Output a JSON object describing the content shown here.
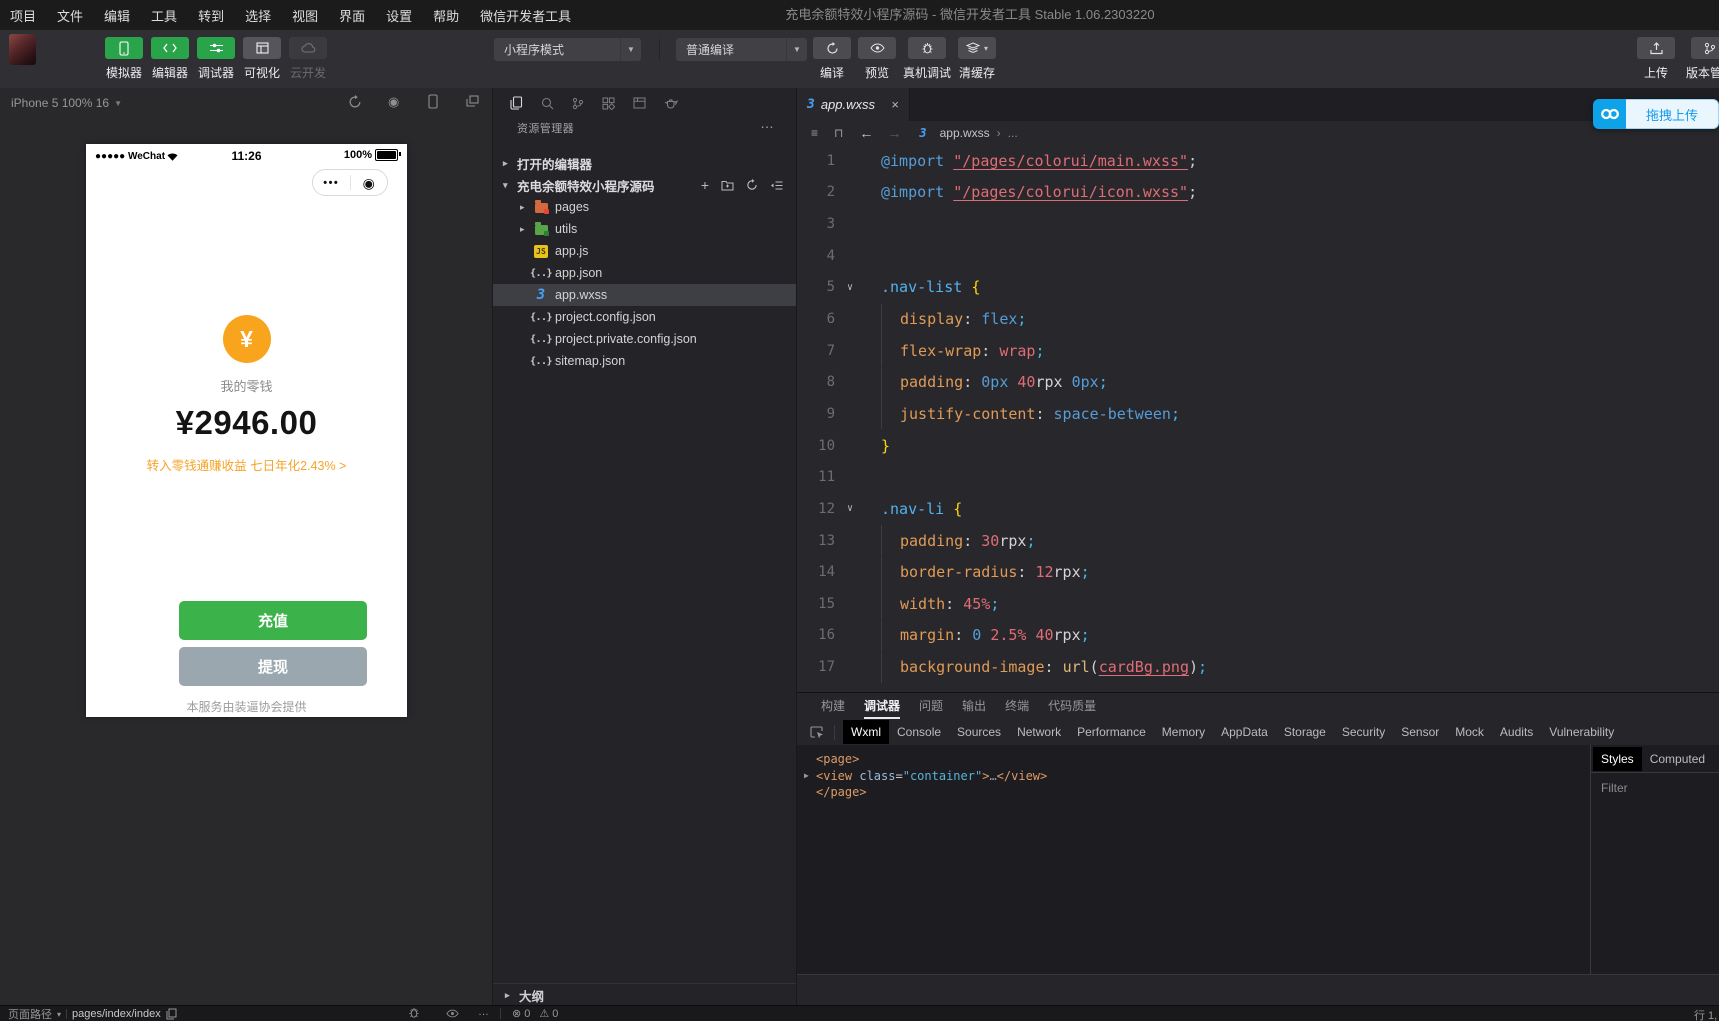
{
  "window": {
    "menu": [
      "项目",
      "文件",
      "编辑",
      "工具",
      "转到",
      "选择",
      "视图",
      "界面",
      "设置",
      "帮助",
      "微信开发者工具"
    ],
    "title": "充电余额特效小程序源码 - 微信开发者工具 Stable 1.06.2303220"
  },
  "toolbar": {
    "mode_buttons": [
      {
        "label": "模拟器",
        "icon": "phone",
        "state": "active"
      },
      {
        "label": "编辑器",
        "icon": "code",
        "state": "active"
      },
      {
        "label": "调试器",
        "icon": "sliders",
        "state": "active"
      },
      {
        "label": "可视化",
        "icon": "layout",
        "state": "normal"
      },
      {
        "label": "云开发",
        "icon": "cloud",
        "state": "disabled"
      }
    ],
    "mode_select": "小程序模式",
    "compile_select": "普通编译",
    "action_buttons": [
      {
        "label": "编译",
        "icon": "refresh"
      },
      {
        "label": "预览",
        "icon": "eye"
      },
      {
        "label": "真机调试",
        "icon": "bug"
      },
      {
        "label": "清缓存",
        "icon": "layers",
        "caret": true
      }
    ],
    "right_buttons": [
      {
        "label": "上传",
        "icon": "upload"
      },
      {
        "label": "版本管理",
        "icon": "branch"
      }
    ],
    "drag_upload_label": "拖拽上传"
  },
  "simulator": {
    "device": "iPhone 5 100% 16",
    "carrier": "●●●●● WeChat",
    "time": "11:26",
    "battery": "100%",
    "capsule_dots": "•••",
    "capsule_target": "◉",
    "coin_symbol": "¥",
    "wallet_label": "我的零钱",
    "balance": "¥2946.00",
    "promo_link": "转入零钱通赚收益 七日年化2.43% >",
    "recharge_label": "充值",
    "withdraw_label": "提现",
    "footer": "本服务由装逼协会提供"
  },
  "explorer": {
    "title": "资源管理器",
    "more": "…",
    "open_editors": "打开的编辑器",
    "project": "充电余额特效小程序源码",
    "files": [
      {
        "label": "pages",
        "icon": "folder-orange",
        "arrow": true
      },
      {
        "label": "utils",
        "icon": "folder-green",
        "arrow": true
      },
      {
        "label": "app.js",
        "icon": "js"
      },
      {
        "label": "app.json",
        "icon": "json"
      },
      {
        "label": "app.wxss",
        "icon": "wxss",
        "selected": true
      },
      {
        "label": "project.config.json",
        "icon": "json"
      },
      {
        "label": "project.private.config.json",
        "icon": "json"
      },
      {
        "label": "sitemap.json",
        "icon": "json"
      }
    ],
    "outline": "大纲"
  },
  "editor": {
    "tab": "app.wxss",
    "breadcrumb_file": "app.wxss",
    "breadcrumb_sep": "›",
    "breadcrumb_more": "...",
    "lines": [
      {
        "n": 1,
        "tokens": [
          [
            "kw",
            "@import"
          ],
          [
            "plain",
            " "
          ],
          [
            "str",
            "\"/pages/colorui/main.wxss\""
          ],
          [
            "plain",
            ";"
          ]
        ]
      },
      {
        "n": 2,
        "tokens": [
          [
            "kw",
            "@import"
          ],
          [
            "plain",
            " "
          ],
          [
            "str",
            "\"/pages/colorui/icon.wxss\""
          ],
          [
            "plain",
            ";"
          ]
        ]
      },
      {
        "n": 3,
        "tokens": []
      },
      {
        "n": 4,
        "tokens": []
      },
      {
        "n": 5,
        "fold": true,
        "tokens": [
          [
            "sel",
            ".nav-list"
          ],
          [
            "plain",
            " "
          ],
          [
            "brace",
            "{"
          ]
        ]
      },
      {
        "n": 6,
        "ind": true,
        "tokens": [
          [
            "prop",
            "display"
          ],
          [
            "plain",
            ": "
          ],
          [
            "kw",
            "flex"
          ],
          [
            "semi",
            ";"
          ]
        ]
      },
      {
        "n": 7,
        "ind": true,
        "tokens": [
          [
            "prop",
            "flex-wrap"
          ],
          [
            "plain",
            ": "
          ],
          [
            "red",
            "wrap"
          ],
          [
            "semi",
            ";"
          ]
        ]
      },
      {
        "n": 8,
        "ind": true,
        "tokens": [
          [
            "prop",
            "padding"
          ],
          [
            "plain",
            ": "
          ],
          [
            "kw",
            "0px"
          ],
          [
            "plain",
            " "
          ],
          [
            "red",
            "40"
          ],
          [
            "unit",
            "rpx"
          ],
          [
            "plain",
            " "
          ],
          [
            "kw",
            "0px"
          ],
          [
            "semi",
            ";"
          ]
        ]
      },
      {
        "n": 9,
        "ind": true,
        "tokens": [
          [
            "prop",
            "justify-content"
          ],
          [
            "plain",
            ": "
          ],
          [
            "kw",
            "space-between"
          ],
          [
            "semi",
            ";"
          ]
        ]
      },
      {
        "n": 10,
        "tokens": [
          [
            "brace",
            "}"
          ]
        ]
      },
      {
        "n": 11,
        "tokens": []
      },
      {
        "n": 12,
        "fold": true,
        "tokens": [
          [
            "sel",
            ".nav-li"
          ],
          [
            "plain",
            " "
          ],
          [
            "brace",
            "{"
          ]
        ]
      },
      {
        "n": 13,
        "ind": true,
        "tokens": [
          [
            "prop",
            "padding"
          ],
          [
            "plain",
            ": "
          ],
          [
            "red",
            "30"
          ],
          [
            "unit",
            "rpx"
          ],
          [
            "semi",
            ";"
          ]
        ]
      },
      {
        "n": 14,
        "ind": true,
        "tokens": [
          [
            "prop",
            "border-radius"
          ],
          [
            "plain",
            ": "
          ],
          [
            "red",
            "12"
          ],
          [
            "unit",
            "rpx"
          ],
          [
            "semi",
            ";"
          ]
        ]
      },
      {
        "n": 15,
        "ind": true,
        "tokens": [
          [
            "prop",
            "width"
          ],
          [
            "plain",
            ": "
          ],
          [
            "red",
            "45%"
          ],
          [
            "semi",
            ";"
          ]
        ]
      },
      {
        "n": 16,
        "ind": true,
        "tokens": [
          [
            "prop",
            "margin"
          ],
          [
            "plain",
            ": "
          ],
          [
            "kw",
            "0"
          ],
          [
            "plain",
            " "
          ],
          [
            "red",
            "2.5%"
          ],
          [
            "plain",
            " "
          ],
          [
            "red",
            "40"
          ],
          [
            "unit",
            "rpx"
          ],
          [
            "semi",
            ";"
          ]
        ]
      },
      {
        "n": 17,
        "ind": true,
        "tokens": [
          [
            "prop",
            "background-image"
          ],
          [
            "plain",
            ": "
          ],
          [
            "fn",
            "url"
          ],
          [
            "plain",
            "("
          ],
          [
            "str",
            "cardBg.png"
          ],
          [
            "plain",
            ")"
          ],
          [
            "semi",
            ";"
          ]
        ]
      }
    ]
  },
  "debugger": {
    "panel_tabs": [
      "构建",
      "调试器",
      "问题",
      "输出",
      "终端",
      "代码质量"
    ],
    "active_panel_tab": "调试器",
    "devtools_tabs": [
      "Wxml",
      "Console",
      "Sources",
      "Network",
      "Performance",
      "Memory",
      "AppData",
      "Storage",
      "Security",
      "Sensor",
      "Mock",
      "Audits",
      "Vulnerability"
    ],
    "active_devtools_tab": "Wxml",
    "wxml": [
      {
        "tokens": [
          [
            "tag",
            "<page>"
          ]
        ]
      },
      {
        "arrow": true,
        "tokens": [
          [
            "tag",
            "<view"
          ],
          [
            "plain",
            " "
          ],
          [
            "attr",
            "class"
          ],
          [
            "plain",
            "="
          ],
          [
            "val",
            "\"container\""
          ],
          [
            "tag",
            ">"
          ],
          [
            "dim",
            "…"
          ],
          [
            "tag",
            "</view>"
          ]
        ]
      },
      {
        "tokens": [
          [
            "tag",
            "</page>"
          ]
        ]
      }
    ],
    "sidebar_tabs": [
      "Styles",
      "Computed"
    ],
    "active_sidebar_tab": "Styles",
    "filter_label": "Filter"
  },
  "status_bar": {
    "page_path_label": "页面路径",
    "page_path": "pages/index/index",
    "errors": "0",
    "warnings": "0",
    "line_col": "行 1,"
  },
  "colors": {
    "accent_green": "#2aa44b",
    "wechat_button_green": "#3cb34a",
    "coin_orange": "#f8a41c",
    "promo_orange": "#f6a428",
    "drag_upload_blue": "#0ea2e9"
  }
}
